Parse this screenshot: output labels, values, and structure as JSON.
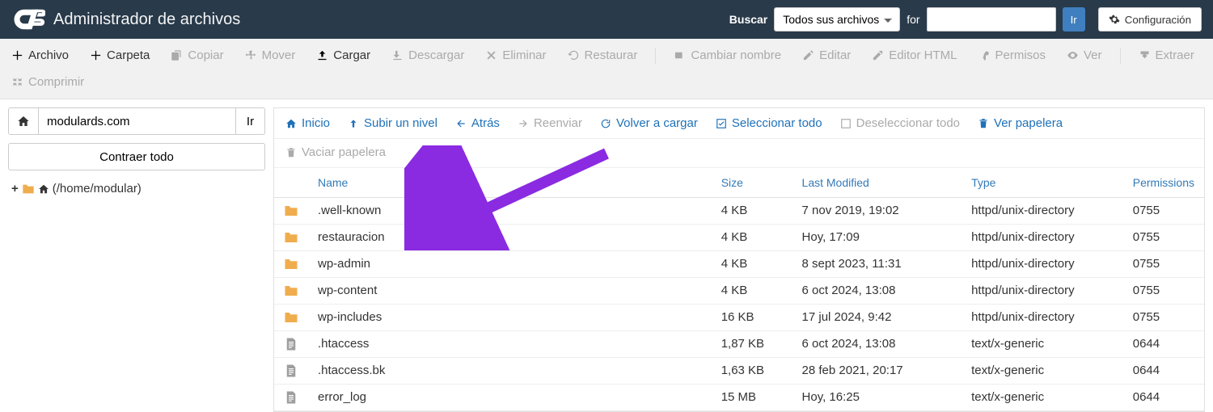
{
  "brand": {
    "title": "Administrador de archivos"
  },
  "search": {
    "label": "Buscar",
    "select_value": "Todos sus archivos",
    "for_label": "for",
    "input_value": "",
    "go": "Ir"
  },
  "settings": {
    "label": "Configuración"
  },
  "toolbar": {
    "file": "Archivo",
    "folder": "Carpeta",
    "copy": "Copiar",
    "move": "Mover",
    "upload": "Cargar",
    "download": "Descargar",
    "delete": "Eliminar",
    "restore": "Restaurar",
    "rename": "Cambiar nombre",
    "edit": "Editar",
    "html_editor": "Editor HTML",
    "permissions": "Permisos",
    "view": "Ver",
    "extract": "Extraer",
    "compress": "Comprimir"
  },
  "sidebar": {
    "path_value": "modulards.com",
    "path_go": "Ir",
    "collapse": "Contraer todo",
    "tree": {
      "root": "(/home/modular)"
    }
  },
  "actions": {
    "home": "Inicio",
    "up": "Subir un nivel",
    "back": "Atrás",
    "forward": "Reenviar",
    "reload": "Volver a cargar",
    "select_all": "Seleccionar todo",
    "deselect_all": "Deseleccionar todo",
    "view_trash": "Ver papelera",
    "empty_trash": "Vaciar papelera"
  },
  "columns": {
    "name": "Name",
    "size": "Size",
    "modified": "Last Modified",
    "type": "Type",
    "permissions": "Permissions"
  },
  "rows": [
    {
      "kind": "folder",
      "name": ".well-known",
      "size": "4 KB",
      "modified": "7 nov 2019, 19:02",
      "type": "httpd/unix-directory",
      "perm": "0755"
    },
    {
      "kind": "folder",
      "name": "restauracion",
      "size": "4 KB",
      "modified": "Hoy, 17:09",
      "type": "httpd/unix-directory",
      "perm": "0755"
    },
    {
      "kind": "folder",
      "name": "wp-admin",
      "size": "4 KB",
      "modified": "8 sept 2023, 11:31",
      "type": "httpd/unix-directory",
      "perm": "0755"
    },
    {
      "kind": "folder",
      "name": "wp-content",
      "size": "4 KB",
      "modified": "6 oct 2024, 13:08",
      "type": "httpd/unix-directory",
      "perm": "0755"
    },
    {
      "kind": "folder",
      "name": "wp-includes",
      "size": "16 KB",
      "modified": "17 jul 2024, 9:42",
      "type": "httpd/unix-directory",
      "perm": "0755"
    },
    {
      "kind": "file",
      "name": ".htaccess",
      "size": "1,87 KB",
      "modified": "6 oct 2024, 13:08",
      "type": "text/x-generic",
      "perm": "0644"
    },
    {
      "kind": "file",
      "name": ".htaccess.bk",
      "size": "1,63 KB",
      "modified": "28 feb 2021, 20:17",
      "type": "text/x-generic",
      "perm": "0644"
    },
    {
      "kind": "file",
      "name": "error_log",
      "size": "15 MB",
      "modified": "Hoy, 16:25",
      "type": "text/x-generic",
      "perm": "0644"
    }
  ]
}
